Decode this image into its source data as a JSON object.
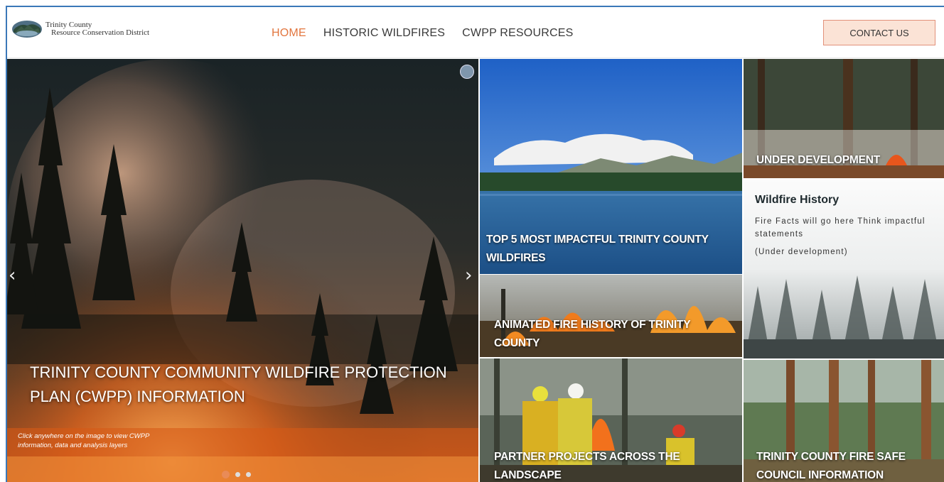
{
  "header": {
    "logo_line1": "Trinity County",
    "logo_line2": "Resource Conservation District",
    "nav": [
      {
        "label": "HOME",
        "active": true
      },
      {
        "label": "HISTORIC WILDFIRES",
        "active": false
      },
      {
        "label": "CWPP RESOURCES",
        "active": false
      }
    ],
    "contact_label": "CONTACT US"
  },
  "hero": {
    "title": "TRINITY COUNTY COMMUNITY WILDFIRE PROTECTION PLAN (CWPP) INFORMATION",
    "hint": "Click anywhere on the image to view CWPP information, data and analysis layers",
    "prev_glyph": "‹",
    "next_glyph": "›",
    "slide_count": 3,
    "active_slide": 1
  },
  "tiles": {
    "top5": "TOP 5 MOST IMPACTFUL TRINITY COUNTY WILDFIRES",
    "animated": "ANIMATED FIRE HISTORY OF TRINITY COUNTY",
    "partner": "PARTNER PROJECTS ACROSS THE LANDSCAPE",
    "under_dev": "UNDER DEVELOPMENT",
    "fire_safe": "TRINITY COUNTY FIRE SAFE COUNCIL INFORMATION"
  },
  "wildfire_history": {
    "title": "Wildfire History",
    "text": "Fire Facts will go here Think impactful statements",
    "status": "(Under development)"
  },
  "colors": {
    "accent": "#e2763f",
    "contact_bg": "#fbe3d6",
    "border": "#3b78b8"
  }
}
